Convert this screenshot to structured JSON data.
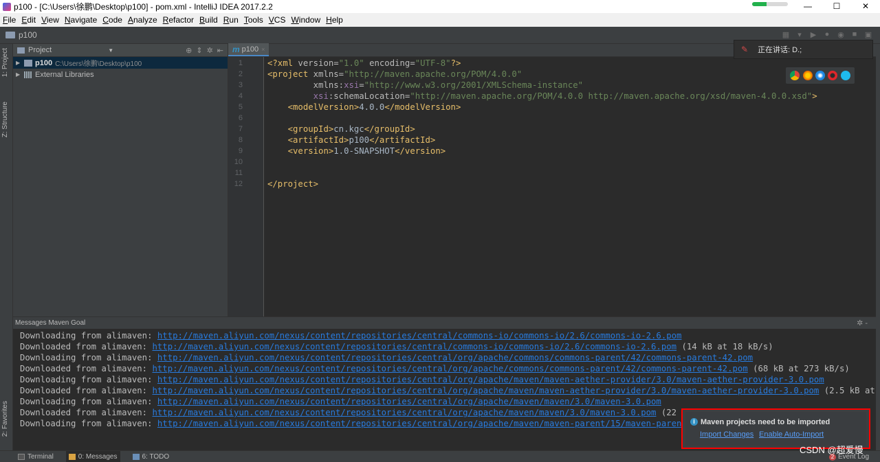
{
  "titlebar": {
    "title": "p100 - [C:\\Users\\徐鹏\\Desktop\\p100] - pom.xml - IntelliJ IDEA 2017.2.2",
    "minimize": "—",
    "maximize": "☐",
    "close": "✕"
  },
  "menu": [
    "File",
    "Edit",
    "View",
    "Navigate",
    "Code",
    "Analyze",
    "Refactor",
    "Build",
    "Run",
    "Tools",
    "VCS",
    "Window",
    "Help"
  ],
  "navbar": {
    "project": "p100"
  },
  "left_tabs": {
    "project": "1: Project",
    "structure": "Z: Structure",
    "favorites": "2: Favorites"
  },
  "project_panel": {
    "title": "Project",
    "tree": [
      {
        "name": "p100",
        "path": "C:\\Users\\徐鹏\\Desktop\\p100"
      },
      {
        "name": "External Libraries",
        "path": ""
      }
    ]
  },
  "editor": {
    "tab": {
      "icon": "m",
      "label": "p100",
      "close": "×"
    },
    "line_numbers": [
      "1",
      "2",
      "3",
      "4",
      "5",
      "6",
      "7",
      "8",
      "9",
      "10",
      "11",
      "12"
    ]
  },
  "speaking": {
    "label": "正在讲话: D.;"
  },
  "messages": {
    "header": "Messages Maven Goal",
    "lines": [
      {
        "prefix": "Downloading from alimaven: ",
        "url": "http://maven.aliyun.com/nexus/content/repositories/central/commons-io/commons-io/2.6/commons-io-2.6.pom",
        "suffix": ""
      },
      {
        "prefix": "Downloaded from alimaven: ",
        "url": "http://maven.aliyun.com/nexus/content/repositories/central/commons-io/commons-io/2.6/commons-io-2.6.pom",
        "suffix": " (14 kB at 18 kB/s)"
      },
      {
        "prefix": "Downloading from alimaven: ",
        "url": "http://maven.aliyun.com/nexus/content/repositories/central/org/apache/commons/commons-parent/42/commons-parent-42.pom",
        "suffix": ""
      },
      {
        "prefix": "Downloaded from alimaven: ",
        "url": "http://maven.aliyun.com/nexus/content/repositories/central/org/apache/commons/commons-parent/42/commons-parent-42.pom",
        "suffix": " (68 kB at 273 kB/s)"
      },
      {
        "prefix": "Downloading from alimaven: ",
        "url": "http://maven.aliyun.com/nexus/content/repositories/central/org/apache/maven/maven-aether-provider/3.0/maven-aether-provider-3.0.pom",
        "suffix": ""
      },
      {
        "prefix": "Downloaded from alimaven: ",
        "url": "http://maven.aliyun.com/nexus/content/repositories/central/org/apache/maven/maven-aether-provider/3.0/maven-aether-provider-3.0.pom",
        "suffix": " (2.5 kB at"
      },
      {
        "prefix": "Downloading from alimaven: ",
        "url": "http://maven.aliyun.com/nexus/content/repositories/central/org/apache/maven/maven/3.0/maven-3.0.pom",
        "suffix": ""
      },
      {
        "prefix": "Downloaded from alimaven: ",
        "url": "http://maven.aliyun.com/nexus/content/repositories/central/org/apache/maven/maven/3.0/maven-3.0.pom",
        "suffix": " (22"
      },
      {
        "prefix": "Downloading from alimaven: ",
        "url": "http://maven.aliyun.com/nexus/content/repositories/central/org/apache/maven/maven-parent/15/maven-parent",
        "suffix": ""
      }
    ]
  },
  "notification": {
    "title": "Maven projects need to be imported",
    "import_changes": "Import Changes",
    "enable_auto_import": "Enable Auto-Import"
  },
  "bottombar": {
    "terminal": "Terminal",
    "messages": "0: Messages",
    "todo": "6: TODO",
    "event_log": "Event Log",
    "event_count": "2",
    "watermark": "CSDN @超爱慢"
  },
  "colors": {
    "editor_bg": "#2b2b2b",
    "panel_bg": "#3c3f41",
    "link": "#287bde",
    "highlight_border": "#ff0000"
  }
}
